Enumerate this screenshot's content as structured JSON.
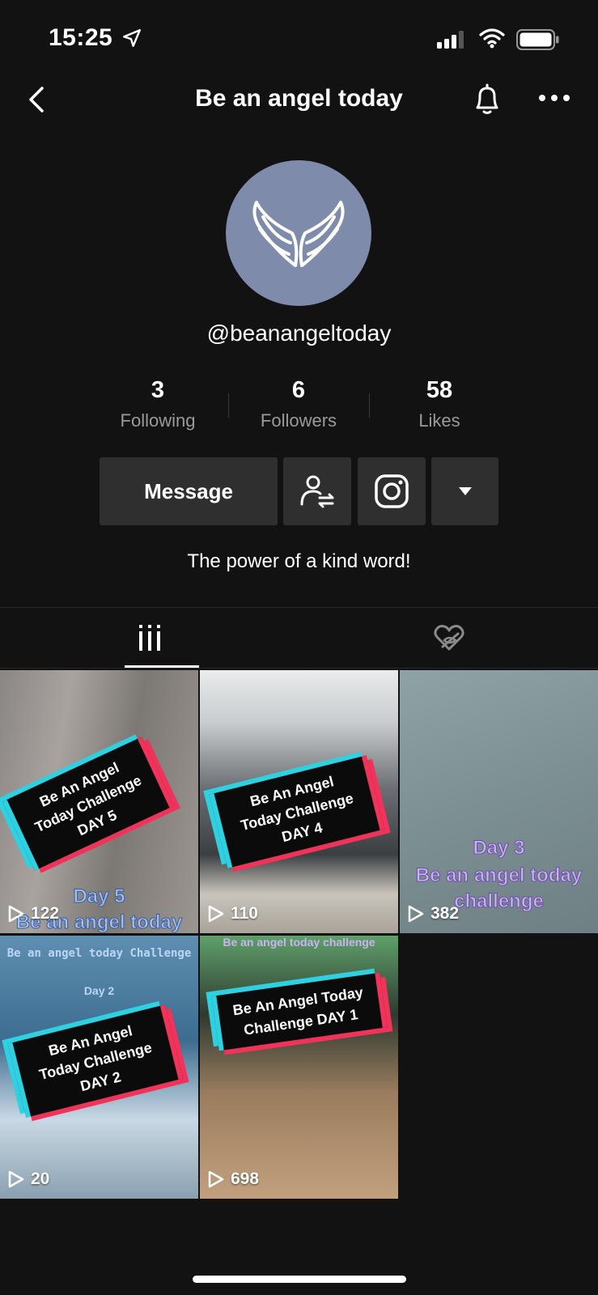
{
  "status_bar": {
    "time": "15:25"
  },
  "header": {
    "title": "Be an angel today"
  },
  "profile": {
    "username": "@beanangeltoday",
    "bio": "The power of a kind word!"
  },
  "stats": [
    {
      "value": "3",
      "label": "Following"
    },
    {
      "value": "6",
      "label": "Followers"
    },
    {
      "value": "58",
      "label": "Likes"
    }
  ],
  "actions": {
    "message_label": "Message"
  },
  "videos": [
    {
      "banner": "Be An Angel Today Challenge DAY 5",
      "overlay_top": "Day 5",
      "overlay_bottom": "Be an angel today",
      "views": "122"
    },
    {
      "banner": "Be An Angel Today Challenge DAY 4",
      "overlay_top": "",
      "overlay_bottom": "",
      "views": "110"
    },
    {
      "banner": "",
      "overlay_top": "Day 3",
      "overlay_bottom": "Be an angel today challenge",
      "views": "382"
    },
    {
      "banner": "Be An Angel Today Challenge DAY 2",
      "overlay_top": "Be an angel today Challenge",
      "overlay_bottom": "Day 2",
      "views": "20"
    },
    {
      "banner": "Be An Angel Today Challenge DAY 1",
      "overlay_top": "Be an angel today challenge",
      "overlay_bottom": "",
      "views": "698"
    }
  ],
  "colors": {
    "background": "#121212",
    "avatar_bg": "#7e8bab",
    "button_bg": "#2f2f2f",
    "accent_cyan": "#2fd0e0",
    "accent_red": "#f0335a"
  }
}
